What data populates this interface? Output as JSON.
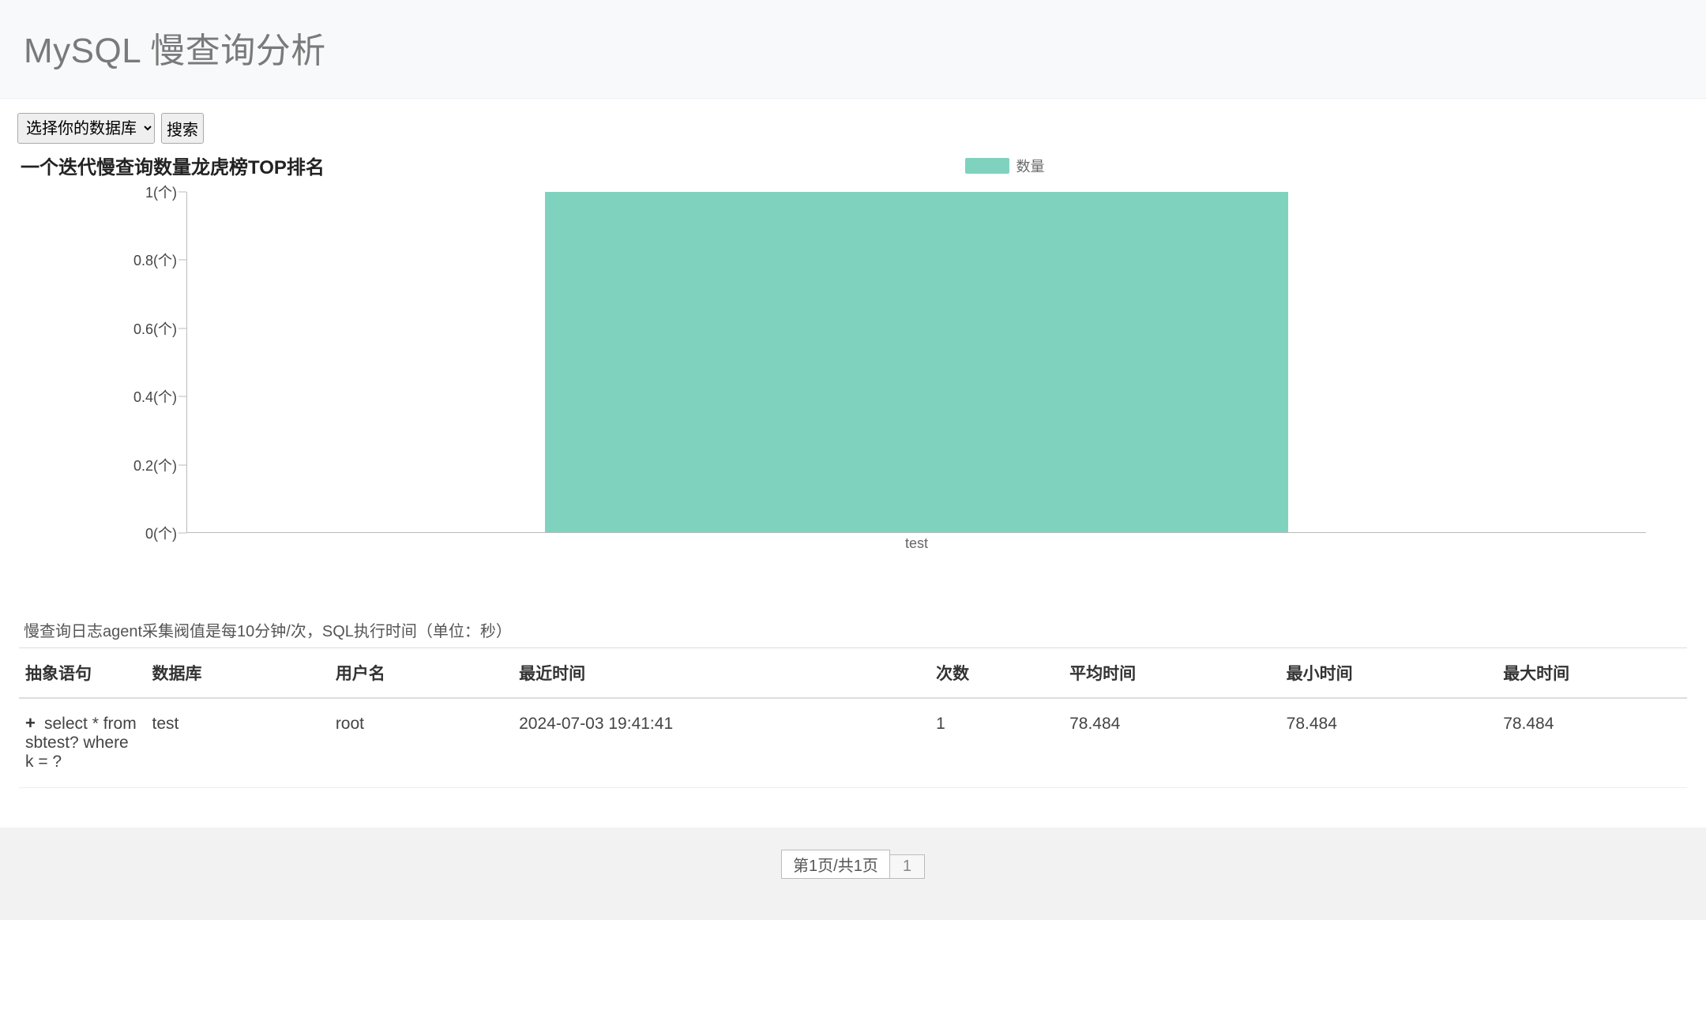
{
  "header": {
    "title": "MySQL 慢查询分析"
  },
  "controls": {
    "db_select_label": "选择你的数据库",
    "search_label": "搜索"
  },
  "chart_title": "一个迭代慢查询数量龙虎榜TOP排名",
  "legend": {
    "label": "数量",
    "color": "#7fd3be"
  },
  "chart_data": {
    "type": "bar",
    "categories": [
      "test"
    ],
    "values": [
      1
    ],
    "title": "一个迭代慢查询数量龙虎榜TOP排名",
    "xlabel": "",
    "ylabel": "",
    "ylim": [
      0,
      1
    ],
    "y_ticks": [
      0,
      0.2,
      0.4,
      0.6,
      0.8,
      1
    ],
    "y_tick_suffix": "(个)",
    "legend": "数量"
  },
  "note": "慢查询日志agent采集阀值是每10分钟/次，SQL执行时间（单位：秒）",
  "table": {
    "headers": {
      "sql": "抽象语句",
      "db": "数据库",
      "user": "用户名",
      "recent": "最近时间",
      "count": "次数",
      "avg": "平均时间",
      "min": "最小时间",
      "max": "最大时间"
    },
    "rows": [
      {
        "sql": "select * from sbtest? where k = ?",
        "db": "test",
        "user": "root",
        "recent": "2024-07-03 19:41:41",
        "count": "1",
        "avg": "78.484",
        "min": "78.484",
        "max": "78.484"
      }
    ]
  },
  "pagination": {
    "info": "第1页/共1页",
    "pages": [
      "1"
    ]
  }
}
